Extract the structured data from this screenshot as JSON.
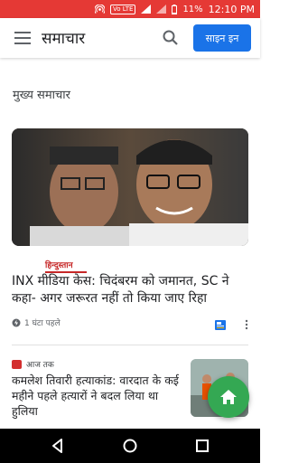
{
  "status_bar": {
    "battery": "11%",
    "time": "12:10 PM",
    "volte_label": "Vo LTE",
    "icons": [
      "hotspot-icon",
      "volte-icon",
      "signal-icon",
      "battery-icon"
    ]
  },
  "app_bar": {
    "title": "समाचार",
    "signin_label": "साइन इन",
    "icons": [
      "menu-icon",
      "search-icon"
    ]
  },
  "section": {
    "title": "मुख्य समाचार"
  },
  "story1": {
    "source": "हिन्दुस्तान",
    "headline": "INX मीडिया केस: चिदंबरम को जमानत, SC ने कहा- अगर जरूरत नहीं तो किया जाए रिहा",
    "time": "1 घंटा पहले"
  },
  "story2": {
    "source": "आज तक",
    "headline": "कमलेश तिवारी हत्याकांड: वारदात के कई महीने पहले हत्यारों ने बदल लिया था हुलिया"
  },
  "colors": {
    "status_bar": "#e53935",
    "signin_button": "#1a73e8",
    "fab": "#34a853"
  }
}
